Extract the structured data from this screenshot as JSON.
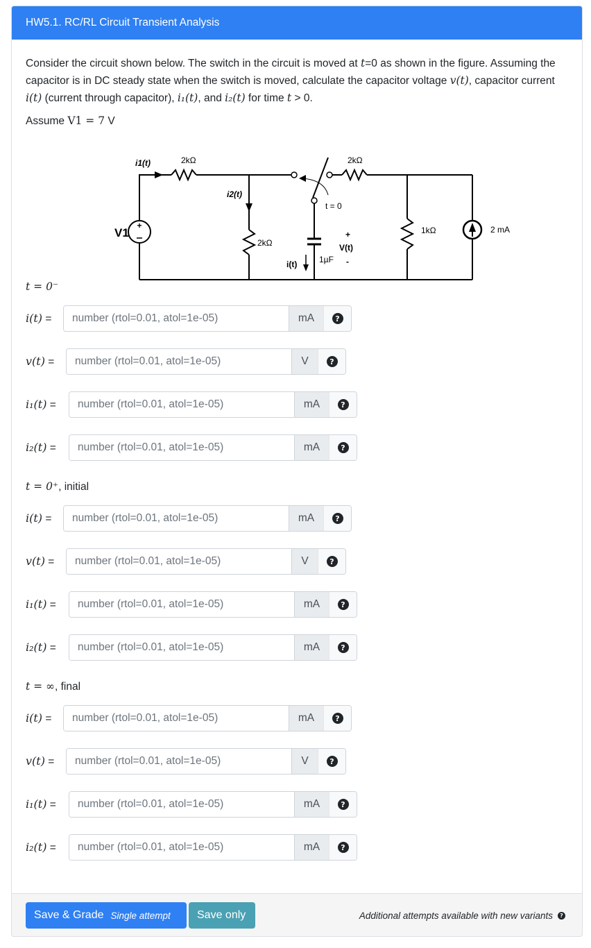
{
  "header": {
    "title": "HW5.1. RC/RL Circuit Transient Analysis"
  },
  "prompt": {
    "p1": "Consider the circuit shown below. The switch in the circuit is moved at ",
    "p1_t": "t",
    "p2": "=0 as shown in the figure. Assuming the capacitor is in DC steady state when the switch is moved, calculate the capacitor voltage ",
    "vt": "v(t)",
    "p3": ", capacitor current ",
    "it": "i(t)",
    "p4": " (current through capacitor), ",
    "i1t": "i₁(t)",
    "p5": ", and ",
    "i2t": "i₂(t)",
    "p6": " for time ",
    "t": "t",
    "p7": " > 0."
  },
  "assume": {
    "prefix": "Assume ",
    "expr": "V1 = 7",
    "unit": " V"
  },
  "circuit": {
    "source_label": "V1",
    "r1_label": "2kΩ",
    "r2_label": "2kΩ",
    "r3_label": "2kΩ",
    "r4_label": "1kΩ",
    "cap_label": "1µF",
    "current_source_label": "2 mA",
    "i1_label": "i1(t)",
    "i2_label": "i2(t)",
    "i_label": "i(t)",
    "v_label": "V(t)",
    "v_plus": "+",
    "v_minus": "-",
    "switch_label": "t = 0"
  },
  "placeholder": "number (rtol=0.01, atol=1e-05)",
  "help_glyph": "?",
  "sections": [
    {
      "label_math": "t = 0⁻",
      "label_text": "",
      "rows": [
        {
          "label": "i(t)",
          "eq": " =",
          "unit": "mA"
        },
        {
          "label": "v(t)",
          "eq": " =",
          "unit": "V"
        },
        {
          "label": "i₁(t)",
          "eq": " =",
          "unit": "mA"
        },
        {
          "label": "i₂(t)",
          "eq": " =",
          "unit": "mA"
        }
      ]
    },
    {
      "label_math": "t = 0⁺",
      "label_text": ", initial",
      "rows": [
        {
          "label": "i(t)",
          "eq": " =",
          "unit": "mA"
        },
        {
          "label": "v(t)",
          "eq": " =",
          "unit": "V"
        },
        {
          "label": "i₁(t)",
          "eq": " =",
          "unit": "mA"
        },
        {
          "label": "i₂(t)",
          "eq": " =",
          "unit": "mA"
        }
      ]
    },
    {
      "label_math": "t = ∞",
      "label_text": ", final",
      "rows": [
        {
          "label": "i(t)",
          "eq": " =",
          "unit": "mA"
        },
        {
          "label": "v(t)",
          "eq": " =",
          "unit": "V"
        },
        {
          "label": "i₁(t)",
          "eq": " =",
          "unit": "mA"
        },
        {
          "label": "i₂(t)",
          "eq": " =",
          "unit": "mA"
        }
      ]
    }
  ],
  "footer": {
    "save_grade_label": "Save & Grade",
    "save_grade_sub": "Single attempt",
    "save_only_label": "Save only",
    "note": "Additional attempts available with new variants",
    "note_icon": "?"
  },
  "colors": {
    "primary": "#2f80f2",
    "info": "#4aa1b3"
  }
}
